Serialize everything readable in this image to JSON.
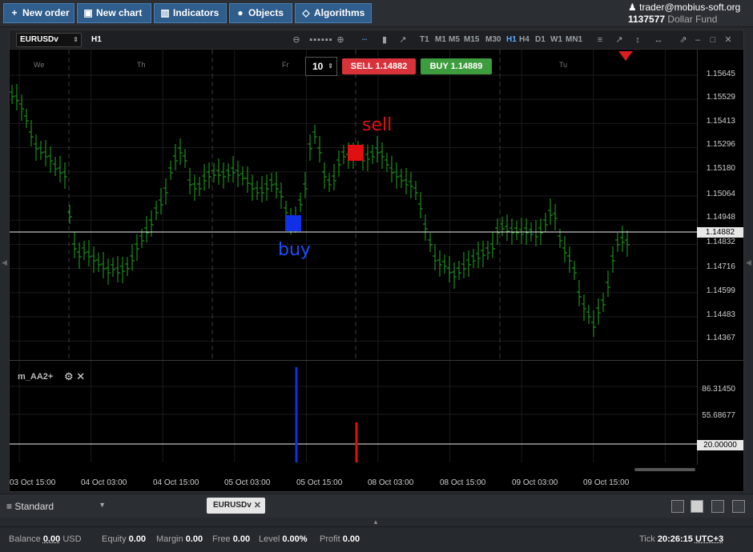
{
  "toolbar": {
    "buttons": [
      {
        "label": "New order",
        "icon": "plus-icon"
      },
      {
        "label": "New chart",
        "icon": "chart-icon"
      },
      {
        "label": "Indicators",
        "icon": "bar-icon"
      },
      {
        "label": "Objects",
        "icon": "objects-icon"
      },
      {
        "label": "Algorithms",
        "icon": "diamond-icon"
      }
    ]
  },
  "user": {
    "email": "trader@mobius-soft.org",
    "account_id": "1137577",
    "account_name": "Dollar Fund"
  },
  "chart": {
    "symbol": "EURUSDv",
    "timeframe": "H1",
    "timeframes": [
      "T1",
      "M1",
      "M5",
      "M15",
      "M30",
      "H1",
      "H4",
      "D1",
      "W1",
      "MN1"
    ],
    "active_timeframe": "H1",
    "lot": "10",
    "sell_label": "SELL 1.14882",
    "buy_label": "BUY 1.14889",
    "current_price": "1.14882",
    "day_labels": [
      "We",
      "Th",
      "Fr",
      "Tu"
    ],
    "price_labels": [
      "1.15645",
      "1.15529",
      "1.15413",
      "1.15296",
      "1.15180",
      "1.15064",
      "1.14948",
      "1.14832",
      "1.14716",
      "1.14599",
      "1.14483",
      "1.14367"
    ],
    "sell_mark": "sell",
    "buy_mark": "buy",
    "indicator_name": "m_AA2+",
    "indicator_labels": [
      "86.31450",
      "55.68677"
    ],
    "indicator_level": "20.00000",
    "time_labels": [
      "03 Oct 15:00",
      "04 Oct 03:00",
      "04 Oct 15:00",
      "05 Oct 03:00",
      "05 Oct 15:00",
      "08 Oct 03:00",
      "08 Oct 15:00",
      "09 Oct 03:00",
      "09 Oct 15:00"
    ]
  },
  "workspace": {
    "name": "Standard",
    "tab": "EURUSDv"
  },
  "status": {
    "balance_label": "Balance",
    "balance": "0.00",
    "currency": "USD",
    "equity_label": "Equity",
    "equity": "0.00",
    "margin_label": "Margin",
    "margin": "0.00",
    "free_label": "Free",
    "free": "0.00",
    "level_label": "Level",
    "level": "0.00%",
    "profit_label": "Profit",
    "profit": "0.00",
    "tick_label": "Tick",
    "time": "20:26:15",
    "tz": "UTC+3"
  },
  "colors": {
    "bull": "#1fa81f",
    "sell": "#e01010",
    "buy": "#1030e8",
    "sell_btn": "#d8333a",
    "buy_btn": "#3d9c3d"
  }
}
